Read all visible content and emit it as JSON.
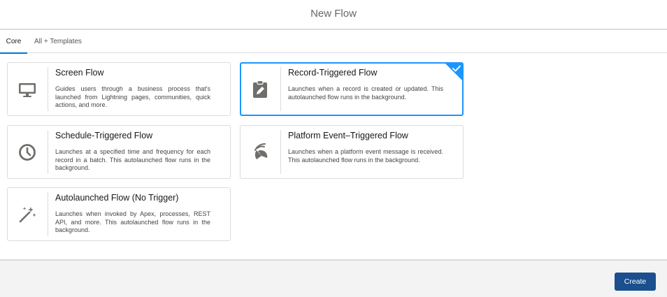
{
  "header": {
    "title": "New Flow"
  },
  "tabs": [
    {
      "label": "Core",
      "active": true
    },
    {
      "label": "All + Templates",
      "active": false
    }
  ],
  "cards": [
    {
      "title": "Screen Flow",
      "description": "Guides users through a business process that's launched from Lightning pages, communities, quick actions, and more.",
      "icon": "desktop-icon",
      "selected": false
    },
    {
      "title": "Record-Triggered Flow",
      "description": "Launches when a record is created or updated. This autolaunched flow runs in the background.",
      "icon": "clipboard-edit-icon",
      "selected": true
    },
    {
      "title": "Schedule-Triggered Flow",
      "description": "Launches at a specified time and frequency for each record in a batch. This autolaunched flow runs in the background.",
      "icon": "clock-icon",
      "selected": false
    },
    {
      "title": "Platform Event–Triggered Flow",
      "description": "Launches when a platform event message is received. This autolaunched flow runs in the background.",
      "icon": "platform-event-icon",
      "selected": false
    },
    {
      "title": "Autolaunched Flow (No Trigger)",
      "description": "Launches when invoked by Apex, processes, REST API, and more. This autolaunched flow runs in the background.",
      "icon": "magic-wand-icon",
      "selected": false
    }
  ],
  "footer": {
    "create_label": "Create"
  },
  "colors": {
    "accent": "#1b96ff",
    "button": "#1b4f8e",
    "icon": "#706e6b"
  }
}
